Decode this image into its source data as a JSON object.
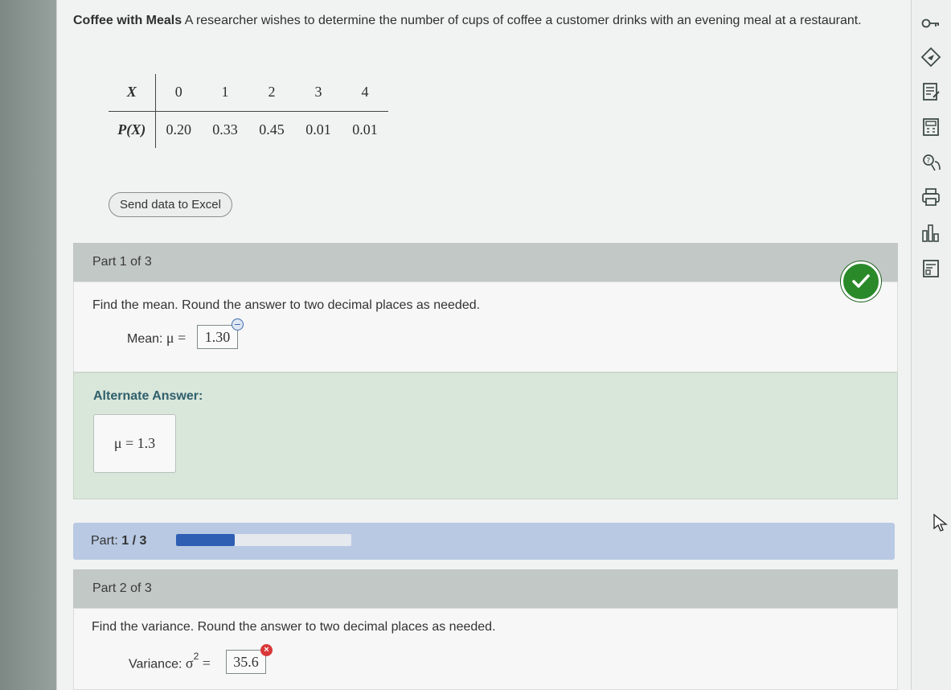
{
  "question": {
    "title": "Coffee with Meals",
    "text": "A researcher wishes to determine the number of cups of coffee a customer drinks with an evening meal at a restaurant."
  },
  "distribution": {
    "x_label": "X",
    "p_label": "P(X)",
    "x_values": [
      "0",
      "1",
      "2",
      "3",
      "4"
    ],
    "p_values": [
      "0.20",
      "0.33",
      "0.45",
      "0.01",
      "0.01"
    ]
  },
  "excel_button": "Send data to Excel",
  "part1": {
    "header": "Part 1 of 3",
    "instruction": "Find the mean. Round the answer to two decimal places as needed.",
    "label": "Mean:",
    "symbol": "μ =",
    "answer": "1.30",
    "status": "correct"
  },
  "alternate": {
    "title": "Alternate Answer:",
    "value": "μ = 1.3"
  },
  "progress": {
    "label": "Part:",
    "value": "1 / 3",
    "fraction": 0.333
  },
  "part2": {
    "header": "Part 2 of 3",
    "instruction": "Find the variance. Round the answer to two decimal places as needed.",
    "label": "Variance:",
    "symbol": "σ",
    "exponent": "2",
    "equals": "=",
    "answer": "35.6",
    "status": "incorrect"
  },
  "toolbar_icons": [
    "key-icon",
    "answer-icon",
    "notes-icon",
    "calculator-icon",
    "help-icon",
    "print-icon",
    "stats-icon",
    "formula-icon"
  ],
  "colors": {
    "correct": "#2a8a2a",
    "incorrect": "#d9383a",
    "progress_fill": "#2e5fb3",
    "alt_title": "#2e5f6b"
  }
}
